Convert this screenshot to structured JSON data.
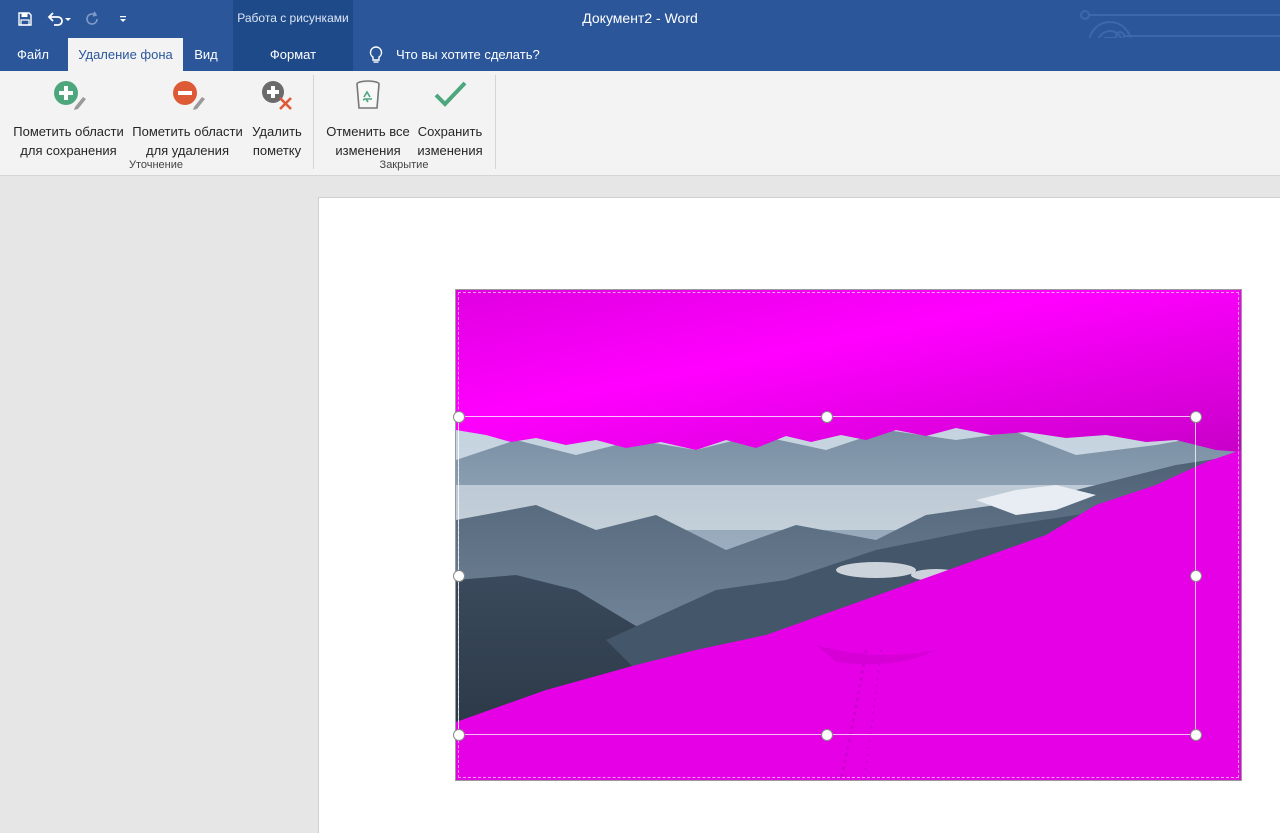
{
  "app": {
    "doc_title": "Документ2  -  Word",
    "context_group": "Работа с рисунками"
  },
  "qat": {
    "save_icon": "save-icon",
    "undo_icon": "undo-icon",
    "redo_icon": "redo-icon",
    "customize_icon": "customize-qat-icon"
  },
  "tabs": [
    {
      "label": "Файл"
    },
    {
      "label": "Удаление фона",
      "active": true
    },
    {
      "label": "Вид"
    },
    {
      "label": "Формат"
    }
  ],
  "tellme": {
    "text": "Что вы хотите сделать?",
    "icon": "lightbulb-icon"
  },
  "ribbon": {
    "groups": [
      {
        "label": "Уточнение",
        "buttons": [
          {
            "line1": "Пометить области",
            "line2": "для сохранения",
            "icon": "mark-keep-icon"
          },
          {
            "line1": "Пометить области",
            "line2": "для удаления",
            "icon": "mark-remove-icon"
          },
          {
            "line1": "Удалить",
            "line2": "пометку",
            "icon": "delete-mark-icon"
          }
        ]
      },
      {
        "label": "Закрытие",
        "buttons": [
          {
            "line1": "Отменить все",
            "line2": "изменения",
            "icon": "discard-icon"
          },
          {
            "line1": "Сохранить",
            "line2": "изменения",
            "icon": "keep-changes-icon"
          }
        ]
      }
    ]
  },
  "colors": {
    "brand": "#2b579a",
    "removal_overlay": "#e600e6",
    "ribbon": "#f3f3f3"
  }
}
